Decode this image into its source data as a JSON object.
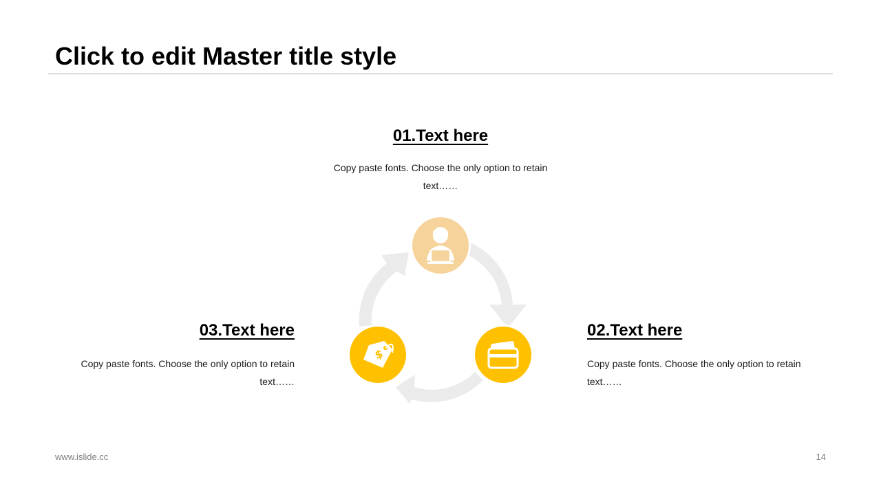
{
  "slide": {
    "title": "Click to edit Master title style",
    "footer_url": "www.islide.cc",
    "page_number": "14"
  },
  "items": [
    {
      "heading": "01.Text here",
      "body": "Copy paste fonts. Choose the only option to retain text……",
      "icon": "person-laptop-icon"
    },
    {
      "heading": "02.Text here",
      "body": "Copy paste fonts. Choose the only option to retain text……",
      "icon": "credit-card-icon"
    },
    {
      "heading": "03.Text here",
      "body": "Copy paste fonts. Choose the only option to retain text……",
      "icon": "price-tag-icon"
    }
  ],
  "colors": {
    "accent": "#ffc000",
    "accent_light": "#f6d39a",
    "arrow": "#ebebeb",
    "rule": "#a6a6a6"
  }
}
